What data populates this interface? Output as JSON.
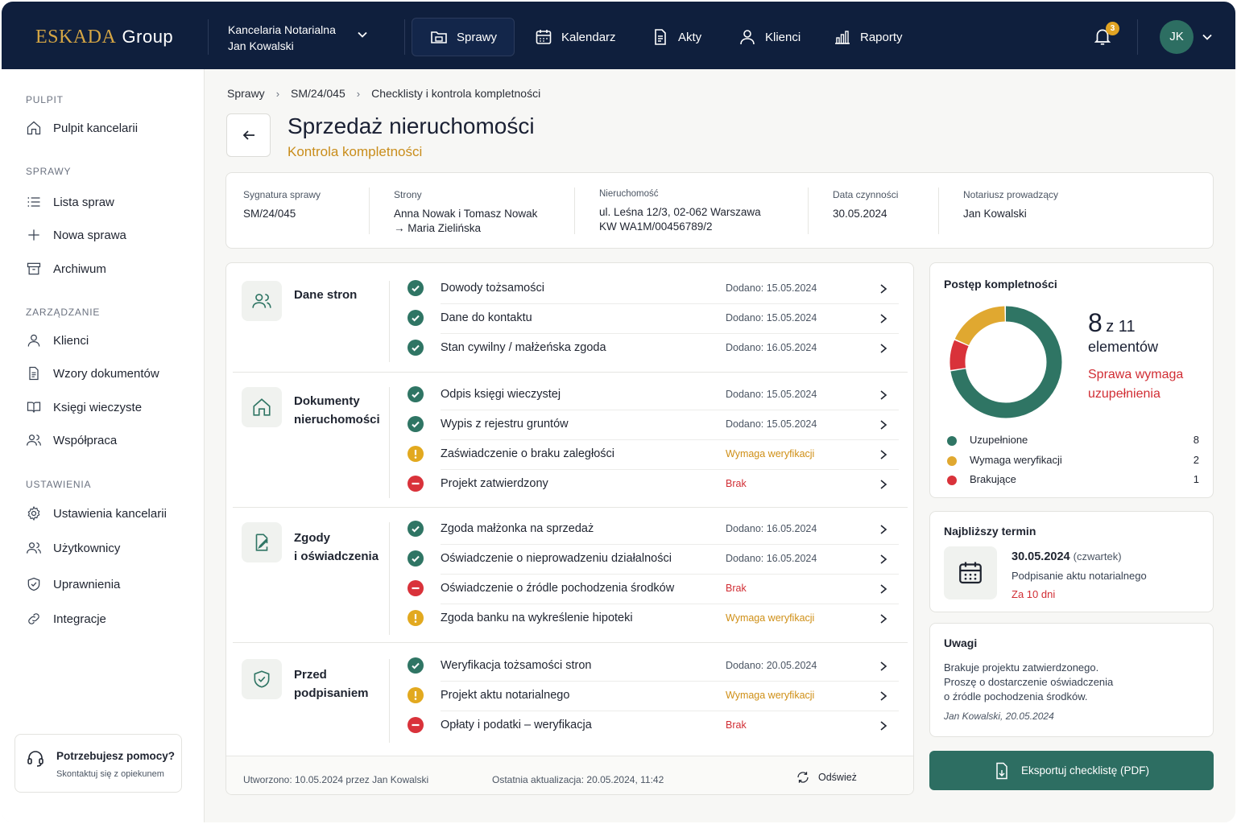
{
  "header": {
    "logo_brand": "ESKADA",
    "logo_suffix": "Group",
    "office_line1": "Kancelaria Notarialna",
    "office_line2": "Jan Kowalski",
    "nav": {
      "sprawy": "Sprawy",
      "kalendarz": "Kalendarz",
      "akty": "Akty",
      "klienci": "Klienci",
      "raporty": "Raporty"
    },
    "notifications_count": "3",
    "avatar_initials": "JK"
  },
  "sidebar": {
    "sec_pulpit": "PULPIT",
    "pulpit_kancelarii": "Pulpit kancelarii",
    "sec_sprawy": "SPRAWY",
    "lista_spraw": "Lista spraw",
    "nowa_sprawa": "Nowa sprawa",
    "archiwum": "Archiwum",
    "sec_zarzadzanie": "ZARZĄDZANIE",
    "klienci": "Klienci",
    "wzory": "Wzory dokumentów",
    "ksiegi": "Księgi wieczyste",
    "wspolpraca": "Współpraca",
    "sec_ustawienia": "USTAWIENIA",
    "ustawienia_kancelarii": "Ustawienia kancelarii",
    "uzytkownicy": "Użytkownicy",
    "uprawnienia": "Uprawnienia",
    "integracje": "Integracje",
    "help_title": "Potrzebujesz pomocy?",
    "help_sub": "Skontaktuj się z opiekunem"
  },
  "breadcrumb": {
    "c1": "Sprawy",
    "c2": "SM/24/045",
    "c3": "Checklisty i kontrola kompletności"
  },
  "page": {
    "title": "Sprzedaż nieruchomości",
    "subtitle": "Kontrola kompletności"
  },
  "info": {
    "sygnatura_label": "Sygnatura sprawy",
    "sygnatura": "SM/24/045",
    "strony_label": "Strony",
    "strony_1": "Anna Nowak i Tomasz Nowak",
    "strony_2": "→ Maria Zielińska",
    "nieruchomosc_label": "Nieruchomość",
    "nieruchomosc_1": "ul. Leśna 12/3, 02-062 Warszawa",
    "nieruchomosc_2": "KW WA1M/00456789/2",
    "data_label": "Data czynności",
    "data": "30.05.2024",
    "notariusz_label": "Notariusz prowadzący",
    "notariusz": "Jan Kowalski"
  },
  "checklist": {
    "g1": {
      "title": "Dane stron",
      "items": [
        {
          "label": "Dowody tożsamości",
          "status": "ok",
          "meta": "Dodano: 15.05.2024"
        },
        {
          "label": "Dane do kontaktu",
          "status": "ok",
          "meta": "Dodano: 15.05.2024"
        },
        {
          "label": "Stan cywilny / małżeńska zgoda",
          "status": "ok",
          "meta": "Dodano: 16.05.2024"
        }
      ]
    },
    "g2": {
      "title_1": "Dokumenty",
      "title_2": "nieruchomości",
      "items": [
        {
          "label": "Odpis księgi wieczystej",
          "status": "ok",
          "meta": "Dodano: 15.05.2024"
        },
        {
          "label": "Wypis z rejestru gruntów",
          "status": "ok",
          "meta": "Dodano: 15.05.2024"
        },
        {
          "label": "Zaświadczenie o braku zaległości",
          "status": "warn",
          "meta": "Wymaga weryfikacji"
        },
        {
          "label": "Projekt zatwierdzony",
          "status": "miss",
          "meta": "Brak"
        }
      ]
    },
    "g3": {
      "title_1": "Zgody",
      "title_2": "i oświadczenia",
      "items": [
        {
          "label": "Zgoda małżonka na sprzedaż",
          "status": "ok",
          "meta": "Dodano: 16.05.2024"
        },
        {
          "label": "Oświadczenie o nieprowadzeniu działalności",
          "status": "ok",
          "meta": "Dodano: 16.05.2024"
        },
        {
          "label": "Oświadczenie o źródle pochodzenia środków",
          "status": "miss",
          "meta": "Brak"
        },
        {
          "label": "Zgoda banku na wykreślenie hipoteki",
          "status": "warn",
          "meta": "Wymaga weryfikacji"
        }
      ]
    },
    "g4": {
      "title_1": "Przed",
      "title_2": "podpisaniem",
      "items": [
        {
          "label": "Weryfikacja tożsamości stron",
          "status": "ok",
          "meta": "Dodano: 20.05.2024"
        },
        {
          "label": "Projekt aktu notarialnego",
          "status": "warn",
          "meta": "Wymaga weryfikacji"
        },
        {
          "label": "Opłaty i podatki – weryfikacja",
          "status": "miss",
          "meta": "Brak"
        }
      ]
    },
    "footer_created": "Utworzono: 10.05.2024 przez Jan Kowalski",
    "footer_updated": "Ostatnia aktualizacja: 20.05.2024, 11:42",
    "refresh": "Odśwież"
  },
  "progress": {
    "title": "Postęp kompletności",
    "count": "8",
    "of_total": "z 11",
    "unit": "elementów",
    "status_1": "Sprawa wymaga",
    "status_2": "uzupełnienia",
    "legend": [
      {
        "label": "Uzupełnione",
        "value": 8,
        "color": "#2f7564"
      },
      {
        "label": "Wymaga weryfikacji",
        "value": 2,
        "color": "#e0a830"
      },
      {
        "label": "Brakujące",
        "value": 1,
        "color": "#d9323a"
      }
    ]
  },
  "deadline": {
    "title": "Najbliższy termin",
    "date": "30.05.2024",
    "weekday": "(czwartek)",
    "desc": "Podpisanie aktu notarialnego",
    "left": "Za 10 dni"
  },
  "notes": {
    "title": "Uwagi",
    "line1": "Brakuje projektu zatwierdzonego.",
    "line2": "Proszę o dostarczenie oświadczenia",
    "line3": "o źródle pochodzenia środków.",
    "author": "Jan Kowalski, 20.05.2024"
  },
  "export_label": "Eksportuj checklistę (PDF)"
}
